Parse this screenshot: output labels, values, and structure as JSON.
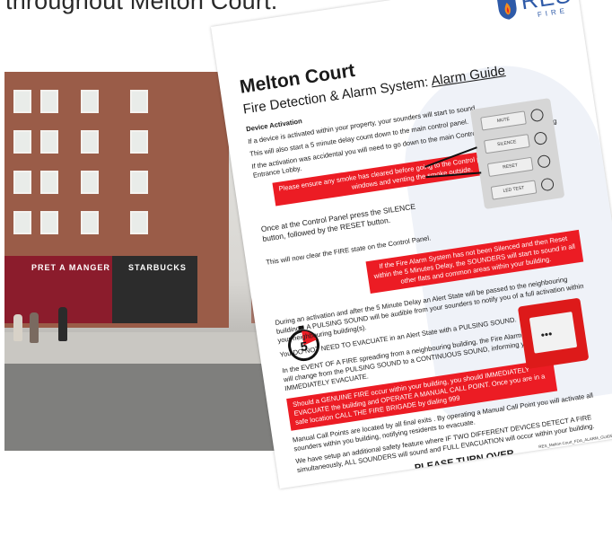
{
  "caption": "throughout Melton Court.",
  "photo": {
    "shop_signs": [
      "PRET A MANGER",
      "STARBUCKS"
    ]
  },
  "guide": {
    "logo_text": "RES",
    "logo_sub": "FIRE",
    "title": "Melton Court",
    "subtitle_prefix": "Fire Detection & Alarm System: ",
    "subtitle_link": "Alarm Guide",
    "section_heading": "Device Activation",
    "p1": "If a device is activated within your property, your sounders will start to sound.",
    "p2": "This will also start a 5 minute delay count down to the main control panel.",
    "p3": "If the activation was accidental you will need to go down to the main Control Panel within your Building Entrance Lobby.",
    "red1": "Please ensure any smoke has cleared before going to the Control panel by opening your windows and venting the smoke outside.",
    "panel_buttons": [
      "MUTE",
      "SILENCE",
      "RESET",
      "LED TEST"
    ],
    "p4": "Once at the Control Panel press the SILENCE button, followed by the RESET button.",
    "p5": "This will now clear the FIRE state on the Control Panel.",
    "red2": "If the Fire Alarm System has not been Silenced and then Reset within the 5 Minutes Delay, the SOUNDERS will start to sound in all other flats and common areas within your building.",
    "timer_number": "5",
    "p6": "During an activation and after the 5 Minute Delay an Alert State will be passed to the neighbouring buildings. A PULSING SOUND will be audible from your sounders to notify you of a full activation within your neighbouring building(s).",
    "p7": "You DO NOT NEED TO EVACUATE in an Alert State with a PULSING SOUND.",
    "p8": "In the EVENT OF A FIRE spreading from a neighbouring building, the Fire Alarm System will change from the PULSING SOUND to a CONTINUOUS SOUND, informing you to IMMEDIATELY EVACUATE.",
    "red3": "Should a GENUINE FIRE occur within your building, you should IMMEDIATELY EVACUATE the building and OPERATE A MANUAL CALL POINT. Once you are in a safe location CALL THE FIRE BRIGADE by dialing 999",
    "p9": "Manual Call Points are located by all final exits . By operating a Manual Call Point you will activate all sounders within you building, notifying residents to evacuate.",
    "p10": "We have setup an additional safety feature where IF TWO DIFFERENT DEVICES DETECT A FIRE simultaneously, ALL SOUNDERS will sound and FULL EVACUATION will occur within your building.",
    "turn_over": "PLEASE TURN OVER",
    "footer_code": "RES_Melton Court_FDA_ALARM_GUIDE_V2"
  },
  "colors": {
    "red": "#ec1c24",
    "brand_blue": "#2e5aa8"
  }
}
